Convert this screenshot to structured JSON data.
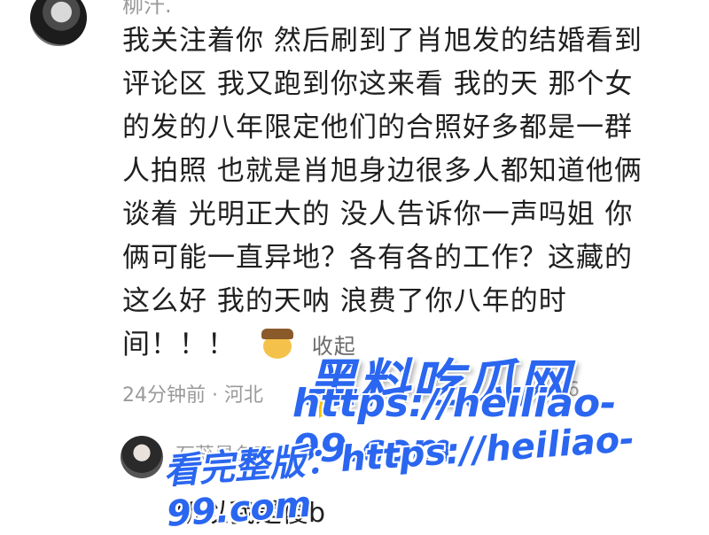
{
  "comment": {
    "author": "柳汗.",
    "lines": [
      "我关注着你 然后刷到了肖旭发的结婚看到",
      "评论区  我又跑到你这来看  我的天  那个女",
      "的发的八年限定他们的合照好多都是一群",
      "人拍照  也就是肖旭身边很多人都知道他俩",
      "谈着  光明正大的  没人告诉你一声吗姐   你",
      "俩可能一直异地？各有各的工作？这藏的",
      "这么好  我的天呐  浪费了你八年的时",
      "间！！！"
    ],
    "emoji_icon": "cowboy-face",
    "collapse_label": "收起",
    "meta": "24分钟前 · 河北",
    "like_count": "6"
  },
  "reply": {
    "author": "石蕊是冬天",
    "text": "所以我是傻b"
  },
  "watermark": {
    "title": "黑料吃瓜网",
    "url": "https://heiliao-99.com",
    "full_prefix": "看完整版："
  },
  "colors": {
    "text": "#1f1f1f",
    "muted": "#9a9a9a",
    "watermark": "#2a66f0"
  }
}
